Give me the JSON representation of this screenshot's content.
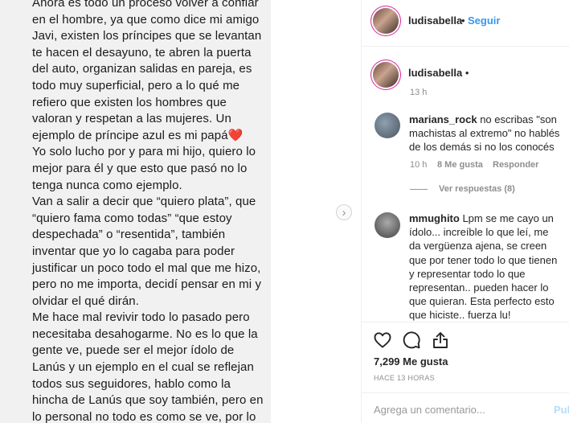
{
  "note": {
    "lines": [
      "Ahora es todo un proceso volver a confiar",
      "en el hombre, ya que como dice mi amigo",
      "Javi, existen los príncipes que se levantan",
      "te hacen el desayuno, te abren la puerta",
      "del auto, organizan salidas en pareja, es",
      "todo muy superficial, pero a lo qué me",
      "refiero que existen los hombres que",
      "valoran y respetan a las mujeres. Un",
      "ejemplo de príncipe azul es mi papá❤️",
      "Yo solo lucho por y para mi hijo, quiero lo",
      "mejor para él y que esto que pasó no lo",
      "tenga nunca como ejemplo.",
      "Van a salir a decir que “quiero plata”, que",
      "“quiero fama como todas” “que estoy",
      "despechada” o “resentida”, también",
      "inventar que yo lo cagaba para poder",
      "justificar un poco todo el mal que me hizo,",
      "pero no me importa, decidí pensar en mi y",
      "olvidar el qué dirán.",
      " Me hace mal revivir todo lo pasado pero",
      "necesitaba desahogarme. No es lo que la",
      "gente ve, puede ser el mejor ídolo de",
      "Lanús y un ejemplo en el cual se reflejan",
      "todos sus seguidores, hablo como la",
      "hincha de Lanús que soy también, pero en",
      "lo personal no todo es como se ve, por lo"
    ]
  },
  "header": {
    "username": "ludisabella",
    "separator": "•",
    "follow_label": "Seguir"
  },
  "caption": {
    "username": "ludisabella",
    "separator": "•",
    "time": "13 h"
  },
  "comments": [
    {
      "username": "marians_rock",
      "text": "no escribas \"son machistas al extremo\" no hablés de los demás si no los conocés",
      "time": "10 h",
      "likes": "8 Me gusta",
      "reply": "Responder",
      "view_replies": "Ver respuestas (8)"
    },
    {
      "username": "mmughito",
      "text": "Lpm se me cayo un ídolo... increíble lo que leí, me da vergüenza ajena, se creen que por tener todo lo que tienen y representar todo lo que representan.. pueden hacer lo que quieran. Esta perfecto esto que hiciste.. fuerza lu!"
    }
  ],
  "actions": {
    "icons": [
      "heart-icon",
      "comment-icon",
      "share-icon"
    ],
    "likes": "7,299 Me gusta",
    "ago": "HACE 13 HORAS"
  },
  "add_comment": {
    "placeholder": "Agrega un comentario...",
    "post_label": "Pul"
  },
  "colors": {
    "link_blue": "#3897f0",
    "post_disabled": "#b2dffc",
    "muted": "#8e8e8e",
    "note_bg": "#f1f1f1"
  }
}
